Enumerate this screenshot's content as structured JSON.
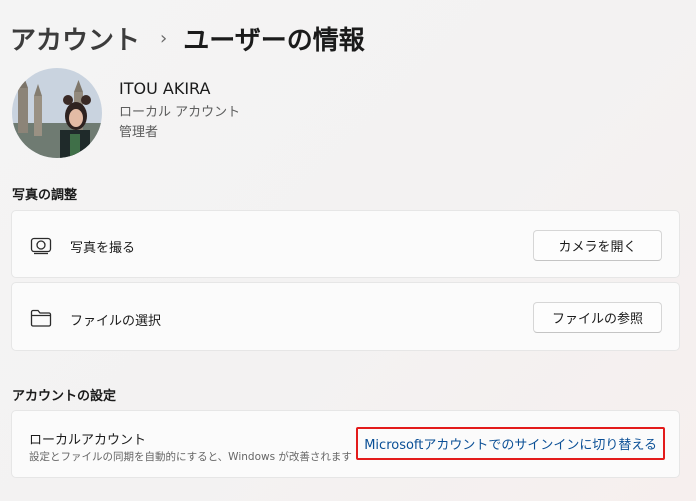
{
  "breadcrumb": {
    "root": "アカウント",
    "separator": "›",
    "current": "ユーザーの情報"
  },
  "user": {
    "name": "ITOU AKIRA",
    "account_type": "ローカル アカウント",
    "role": "管理者"
  },
  "photo_section": {
    "title": "写真の調整",
    "take_photo": {
      "label": "写真を撮る",
      "button": "カメラを開く",
      "icon": "camera-icon"
    },
    "choose_file": {
      "label": "ファイルの選択",
      "button": "ファイルの参照",
      "icon": "folder-icon"
    }
  },
  "account_section": {
    "title": "アカウントの設定",
    "local_account": {
      "title": "ローカルアカウント",
      "description": "設定とファイルの同期を自動的にすると、Windows が改善されます",
      "link": "Microsoftアカウントでのサインインに切り替える"
    }
  },
  "colors": {
    "accent_link": "#0a4f96",
    "highlight_border": "#e31b1b"
  }
}
